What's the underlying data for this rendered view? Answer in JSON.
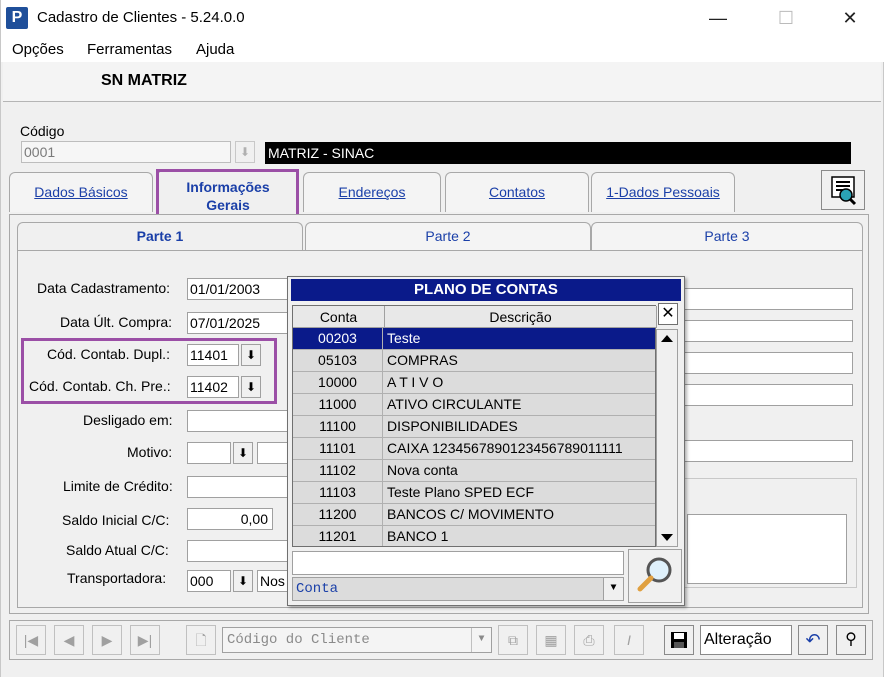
{
  "window": {
    "title": "Cadastro de Clientes - 5.24.0.0",
    "app_icon_letter": "P",
    "minimize": "—",
    "maximize": "☐",
    "close": "✕"
  },
  "menu": {
    "items": [
      {
        "label": "Opções"
      },
      {
        "label": "Ferramentas"
      },
      {
        "label": "Ajuda"
      }
    ]
  },
  "header": {
    "company": "SN MATRIZ"
  },
  "codigo": {
    "label": "Código",
    "value": "0001",
    "description": "MATRIZ - SINAC"
  },
  "tabs": [
    {
      "label": "Dados Básicos"
    },
    {
      "label": "Informações Gerais"
    },
    {
      "label": "Endereços"
    },
    {
      "label": "Contatos"
    },
    {
      "label": "1-Dados Pessoais"
    }
  ],
  "subtabs": [
    {
      "label": "Parte 1"
    },
    {
      "label": "Parte 2"
    },
    {
      "label": "Parte 3"
    }
  ],
  "form": {
    "data_cadastro_label": "Data Cadastramento:",
    "data_cadastro_value": "01/01/2003",
    "data_compra_label": "Data Últ. Compra:",
    "data_compra_value": "07/01/2025",
    "contab_dupl_label": "Cód. Contab. Dupl.:",
    "contab_dupl_value": "11401",
    "contab_chpre_label": "Cód. Contab. Ch. Pre.:",
    "contab_chpre_value": "11402",
    "desligado_label": "Desligado em:",
    "desligado_value": "",
    "motivo_label": "Motivo:",
    "motivo_value": "",
    "limite_label": "Limite de Crédito:",
    "limite_value": "",
    "saldo_inicial_label": "Saldo Inicial C/C:",
    "saldo_inicial_value": "0,00",
    "saldo_atual_label": "Saldo Atual C/C:",
    "saldo_atual_value": "",
    "transportadora_label": "Transportadora:",
    "transportadora_value": "000",
    "transportadora_desc": "Nos"
  },
  "popup": {
    "title": "PLANO DE CONTAS",
    "col_conta": "Conta",
    "col_descricao": "Descrição",
    "rows": [
      {
        "conta": "00203",
        "descricao": "Teste"
      },
      {
        "conta": "05103",
        "descricao": "COMPRAS"
      },
      {
        "conta": "10000",
        "descricao": "A T I V O"
      },
      {
        "conta": "11000",
        "descricao": "ATIVO CIRCULANTE"
      },
      {
        "conta": "11100",
        "descricao": "DISPONIBILIDADES"
      },
      {
        "conta": "11101",
        "descricao": "CAIXA 1234567890123456789011111"
      },
      {
        "conta": "11102",
        "descricao": "Nova conta"
      },
      {
        "conta": "11103",
        "descricao": "Teste Plano SPED ECF"
      },
      {
        "conta": "11200",
        "descricao": "BANCOS C/ MOVIMENTO"
      },
      {
        "conta": "11201",
        "descricao": "BANCO 1"
      }
    ],
    "search_value": "",
    "search_field": "Conta"
  },
  "navbar": {
    "client_combo_placeholder": "Código do Cliente",
    "mode": "Alteração"
  }
}
